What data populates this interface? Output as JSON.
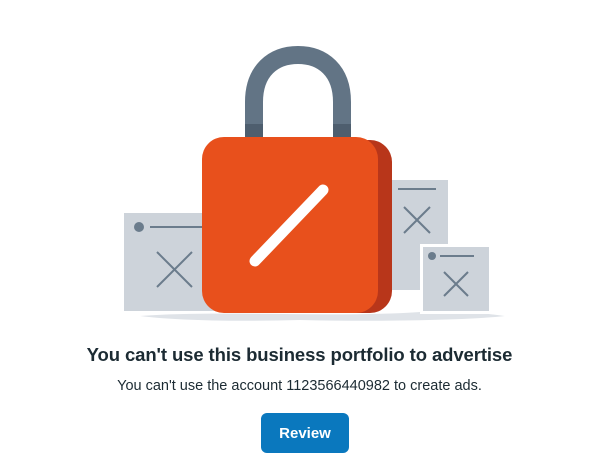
{
  "illustration": {
    "icon": "padlock-icon",
    "lock_color": "#e8501c",
    "lock_shadow_color": "#b8361a",
    "shackle_color": "#627485",
    "card_color": "#cdd3da",
    "card_icon": "close-icon"
  },
  "message": {
    "title": "You can't use this business portfolio to advertise",
    "subtitle": "You can't use the account 1123566440982 to create ads."
  },
  "actions": {
    "review_label": "Review",
    "accent_color": "#0a78be"
  }
}
